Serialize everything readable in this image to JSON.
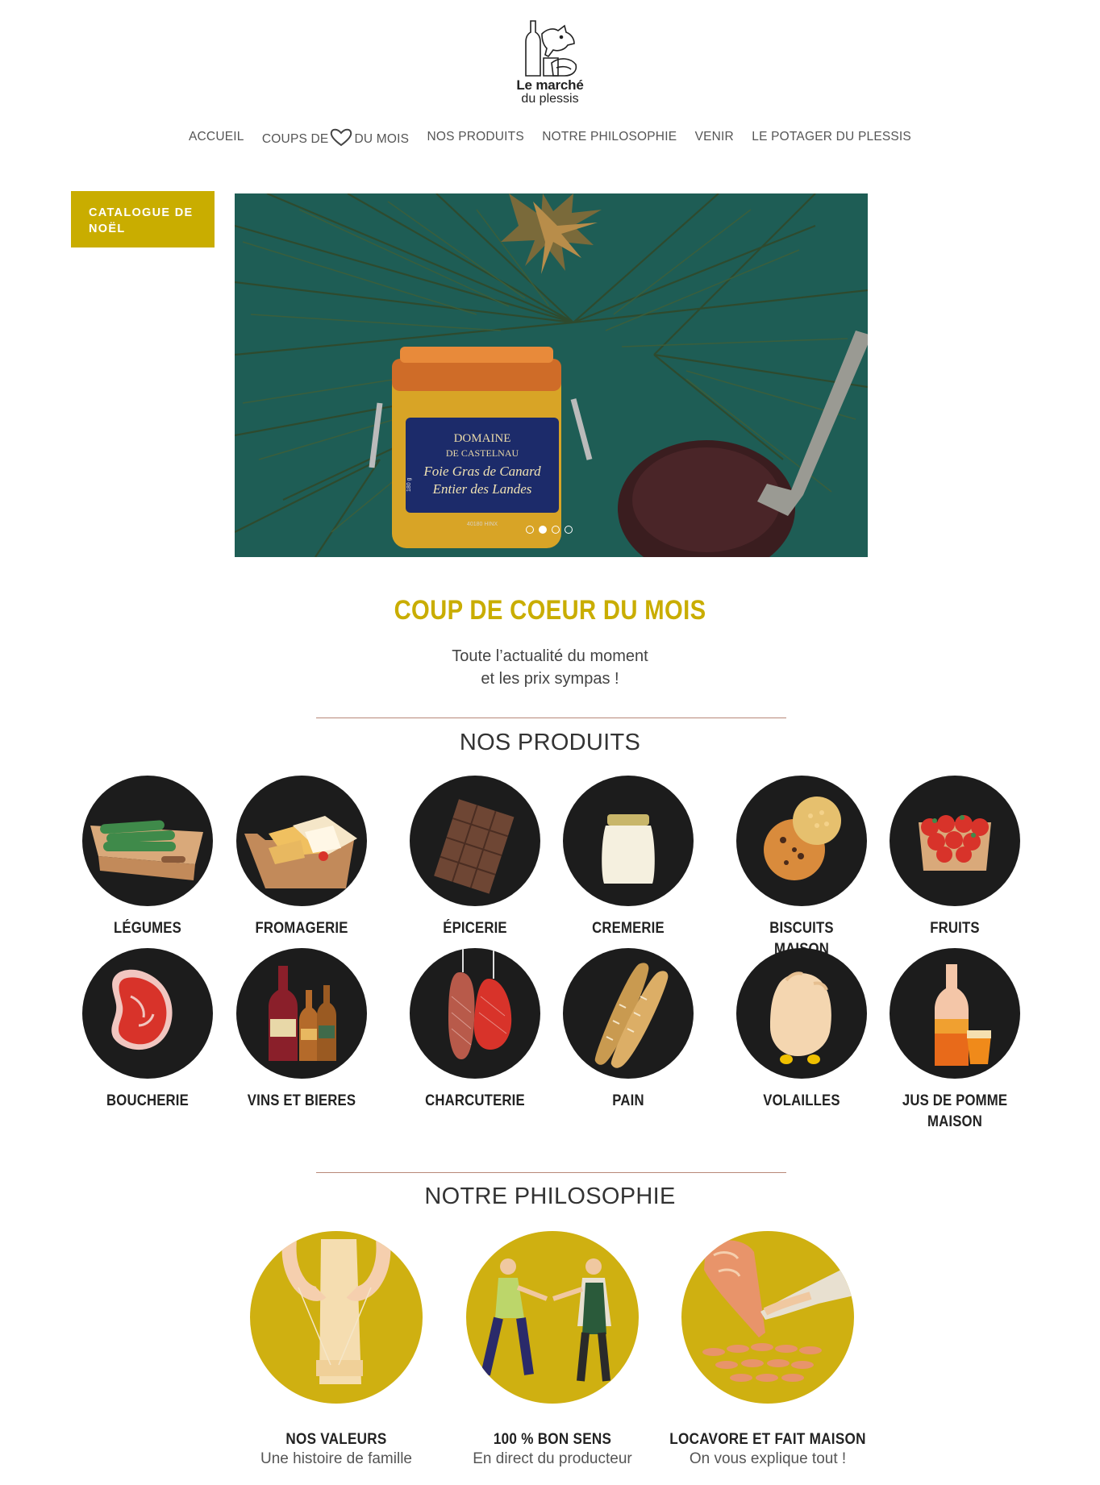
{
  "logo": {
    "line1": "Le marché",
    "line2": "du plessis"
  },
  "nav": {
    "accueil": "ACCUEIL",
    "coups_pre": "COUPS DE",
    "coups_post": "DU MOIS",
    "produits": "NOS PRODUITS",
    "philosophie": "NOTRE PHILOSOPHIE",
    "venir": "VENIR",
    "potager": "LE POTAGER DU PLESSIS"
  },
  "catalogue": {
    "line1": "CATALOGUE DE",
    "line2": "NOËL"
  },
  "hero": {
    "jar_label_1": "DOMAINE",
    "jar_label_2": "DE CASTELNAU",
    "jar_label_3": "Foie Gras de Canard",
    "jar_label_4": "Entier des Landes",
    "jar_small": "40180 HINX",
    "jar_weight": "180 g",
    "slides_total": 4,
    "slide_active": 2
  },
  "coup_de_coeur": {
    "title": "COUP DE COEUR DU MOIS",
    "line1": "Toute l’actualité du moment",
    "line2": "et les prix sympas !"
  },
  "produits": {
    "title": "NOS PRODUITS",
    "row1": [
      "LÉGUMES",
      "FROMAGERIE",
      "ÉPICERIE",
      "CREMERIE",
      "BISCUITS MAISON",
      "FRUITS"
    ],
    "row2": [
      "BOUCHERIE",
      "VINS ET BIERES",
      "CHARCUTERIE",
      "PAIN",
      "VOLAILLES"
    ],
    "jus_line1": "JUS DE POMME",
    "jus_line2": "MAISON"
  },
  "philosophie": {
    "title": "NOTRE PHILOSOPHIE",
    "items": [
      {
        "title": "NOS VALEURS",
        "subtitle": "Une histoire de famille"
      },
      {
        "title": "100 % BON SENS",
        "subtitle": "En direct du producteur"
      },
      {
        "title": "LOCAVORE ET FAIT MAISON",
        "subtitle": "On vous explique tout !"
      }
    ]
  },
  "colors": {
    "accent": "#c9ad00",
    "circle_dark": "#1c1c1c",
    "circle_gold": "#cfb011",
    "divider": "#b88878"
  }
}
